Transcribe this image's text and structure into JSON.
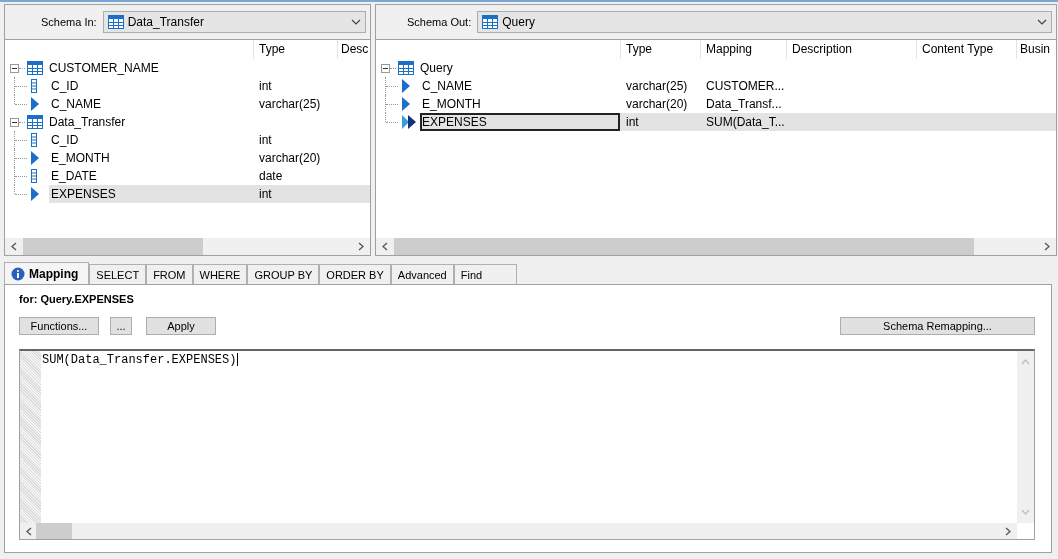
{
  "schema_in": {
    "label": "Schema In:",
    "value": "Data_Transfer"
  },
  "input_tree": {
    "columns": [
      "Type",
      "Desc"
    ],
    "nodes": [
      {
        "name": "CUSTOMER_NAME",
        "expanded": true,
        "children": [
          {
            "name": "C_ID",
            "kind": "column",
            "type": "int",
            "selected": false
          },
          {
            "name": "C_NAME",
            "kind": "field",
            "type": "varchar(25)",
            "selected": false
          }
        ]
      },
      {
        "name": "Data_Transfer",
        "expanded": true,
        "children": [
          {
            "name": "C_ID",
            "kind": "column",
            "type": "int",
            "selected": false
          },
          {
            "name": "E_MONTH",
            "kind": "field",
            "type": "varchar(20)",
            "selected": false
          },
          {
            "name": "E_DATE",
            "kind": "column",
            "type": "date",
            "selected": false
          },
          {
            "name": "EXPENSES",
            "kind": "field",
            "type": "int",
            "selected": true
          }
        ]
      }
    ]
  },
  "schema_out": {
    "label": "Schema Out:",
    "value": "Query"
  },
  "output_tree": {
    "columns": [
      "Type",
      "Mapping",
      "Description",
      "Content Type",
      "Busin"
    ],
    "nodes": [
      {
        "name": "Query",
        "expanded": true,
        "children": [
          {
            "name": "C_NAME",
            "kind": "field",
            "type": "varchar(25)",
            "mapping": "CUSTOMER...",
            "selected": false
          },
          {
            "name": "E_MONTH",
            "kind": "field",
            "type": "varchar(20)",
            "mapping": "Data_Transf...",
            "selected": false
          },
          {
            "name": "EXPENSES",
            "kind": "current",
            "type": "int",
            "mapping": "SUM(Data_T...",
            "selected": true
          }
        ]
      }
    ]
  },
  "tabs": [
    {
      "label": "Mapping",
      "selected": true
    },
    {
      "label": "SELECT",
      "selected": false
    },
    {
      "label": "FROM",
      "selected": false
    },
    {
      "label": "WHERE",
      "selected": false
    },
    {
      "label": "GROUP BY",
      "selected": false
    },
    {
      "label": "ORDER BY",
      "selected": false
    },
    {
      "label": "Advanced",
      "selected": false
    },
    {
      "label": "Find",
      "selected": false
    }
  ],
  "mapping_for": "for: Query.EXPENSES",
  "buttons": [
    {
      "label": "Functions..."
    },
    {
      "label": "..."
    },
    {
      "label": "Apply"
    }
  ],
  "remap_button": "Schema Remapping...",
  "editor": {
    "value": "SUM(Data_Transfer.EXPENSES)"
  }
}
